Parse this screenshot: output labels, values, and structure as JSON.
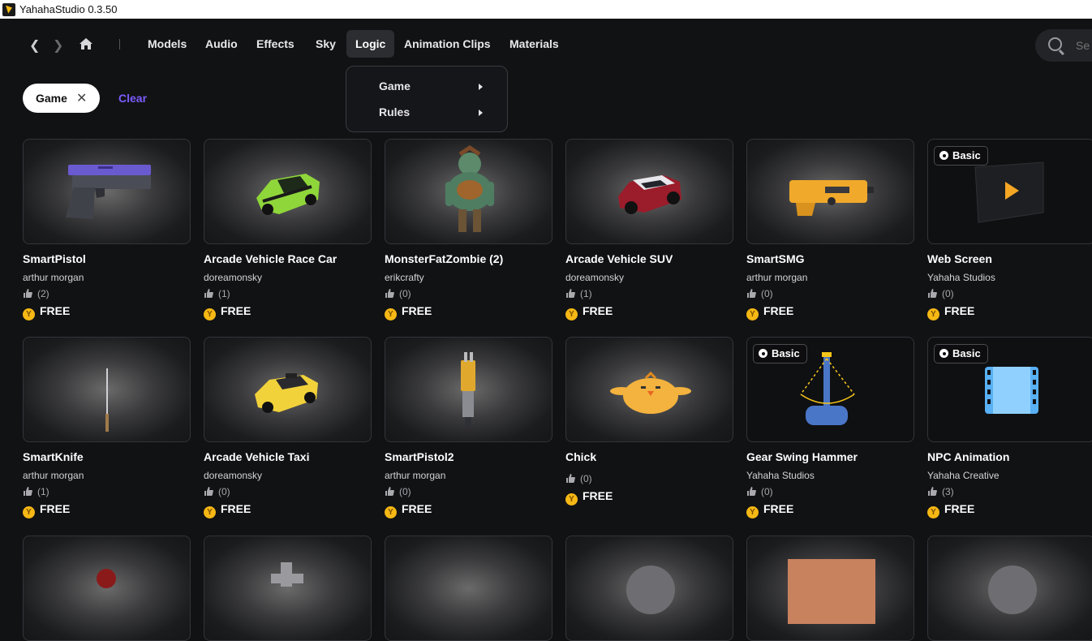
{
  "window": {
    "title": "YahahaStudio 0.3.50"
  },
  "nav": {
    "tabs": [
      {
        "label": "Models"
      },
      {
        "label": "Audio"
      },
      {
        "label": "Effects"
      },
      {
        "label": "Sky"
      },
      {
        "label": "Logic"
      },
      {
        "label": "Animation Clips"
      },
      {
        "label": "Materials"
      }
    ],
    "active_tab": "Logic",
    "search_placeholder": "Se"
  },
  "dropdown": {
    "items": [
      {
        "label": "Game"
      },
      {
        "label": "Rules"
      }
    ]
  },
  "filters": {
    "chip_label": "Game",
    "clear_label": "Clear"
  },
  "colors": {
    "accent": "#7b5cff",
    "coin": "#f5b814",
    "background": "#111214"
  },
  "assets": [
    {
      "name": "SmartPistol",
      "author": "arthur morgan",
      "likes": "(2)",
      "price": "FREE",
      "badge": null,
      "icon": "pistol-icon"
    },
    {
      "name": "Arcade Vehicle Race Car",
      "author": "doreamonsky",
      "likes": "(1)",
      "price": "FREE",
      "badge": null,
      "icon": "race-car-icon"
    },
    {
      "name": "MonsterFatZombie (2)",
      "author": "erikcrafty",
      "likes": "(0)",
      "price": "FREE",
      "badge": null,
      "icon": "zombie-icon"
    },
    {
      "name": "Arcade Vehicle SUV",
      "author": "doreamonsky",
      "likes": "(1)",
      "price": "FREE",
      "badge": null,
      "icon": "suv-icon"
    },
    {
      "name": "SmartSMG",
      "author": "arthur morgan",
      "likes": "(0)",
      "price": "FREE",
      "badge": null,
      "icon": "smg-icon"
    },
    {
      "name": "Web Screen",
      "author": "Yahaha Studios",
      "likes": "(0)",
      "price": "FREE",
      "badge": "Basic",
      "icon": "web-screen-icon"
    },
    {
      "name": "SmartKnife",
      "author": "arthur morgan",
      "likes": "(1)",
      "price": "FREE",
      "badge": null,
      "icon": "knife-icon"
    },
    {
      "name": "Arcade Vehicle Taxi",
      "author": "doreamonsky",
      "likes": "(0)",
      "price": "FREE",
      "badge": null,
      "icon": "taxi-icon"
    },
    {
      "name": "SmartPistol2",
      "author": "arthur morgan",
      "likes": "(0)",
      "price": "FREE",
      "badge": null,
      "icon": "pistol2-icon"
    },
    {
      "name": "Chick",
      "author": "",
      "likes": "(0)",
      "price": "FREE",
      "badge": null,
      "icon": "chick-icon"
    },
    {
      "name": "Gear Swing Hammer",
      "author": "Yahaha Studios",
      "likes": "(0)",
      "price": "FREE",
      "badge": "Basic",
      "icon": "hammer-icon"
    },
    {
      "name": "NPC Animation",
      "author": "Yahaha Creative",
      "likes": "(3)",
      "price": "FREE",
      "badge": "Basic",
      "icon": "film-icon"
    }
  ]
}
